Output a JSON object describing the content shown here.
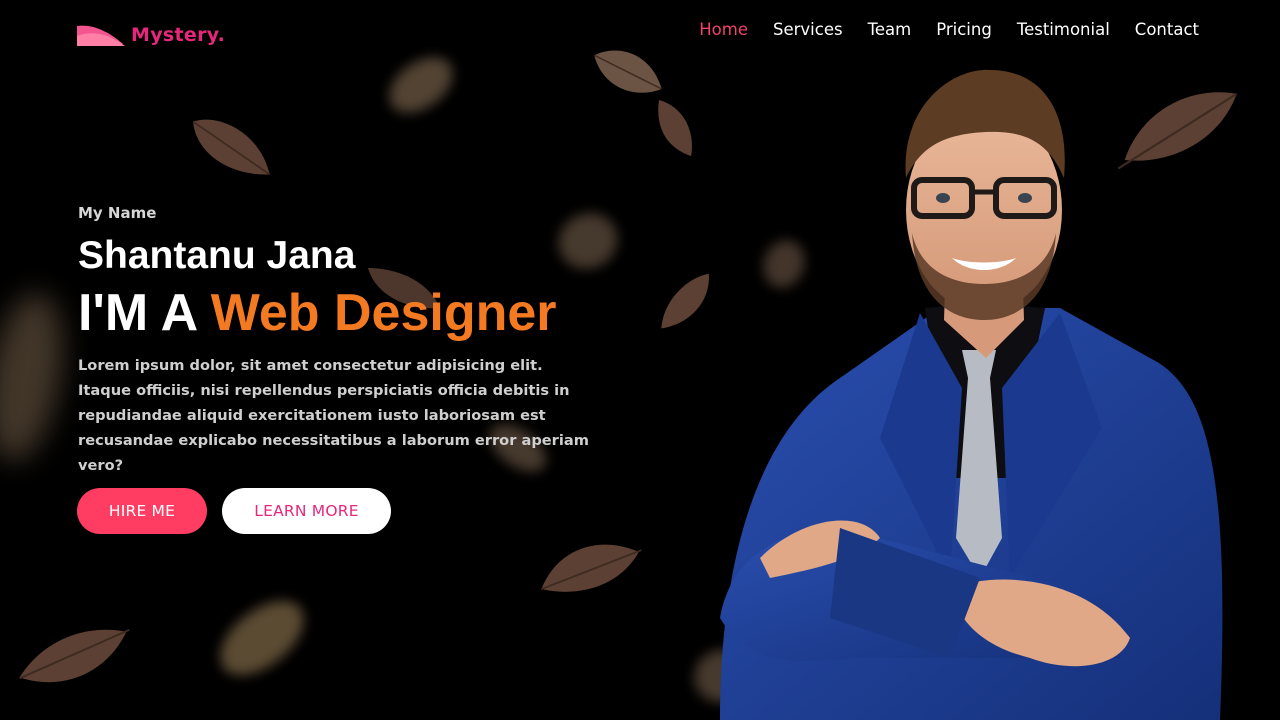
{
  "colors": {
    "accent_pink": "#ff3d63",
    "logo_pink": "#e7277b",
    "web_designer_orange": "#f47a22",
    "nav_active": "#f0436a",
    "background": "#000000",
    "suit_blue": "#1f3f96",
    "leaf_brown": "#5b4033"
  },
  "brand": {
    "logo_icon": "wave-logo-icon",
    "name": "Mystery."
  },
  "nav": {
    "items": [
      {
        "label": "Home",
        "active": true
      },
      {
        "label": "Services",
        "active": false
      },
      {
        "label": "Team",
        "active": false
      },
      {
        "label": "Pricing",
        "active": false
      },
      {
        "label": "Testimonial",
        "active": false
      },
      {
        "label": "Contact",
        "active": false
      }
    ]
  },
  "hero": {
    "eyebrow": "My Name",
    "name": "Shantanu Jana",
    "role_prefix": "I'M A",
    "role_highlight": "Web Designer",
    "description": "Lorem ipsum dolor, sit amet consectetur adipisicing elit. Itaque officiis, nisi repellendus perspiciatis officia debitis in repudiandae aliquid exercitationem iusto laboriosam est recusandae explicabo necessitatibus a laborum error aperiam vero?",
    "hire_button": "HIRE ME",
    "learn_button": "LEARN MORE"
  },
  "portrait": {
    "subject": "man with glasses in blue suit, arms crossed"
  }
}
